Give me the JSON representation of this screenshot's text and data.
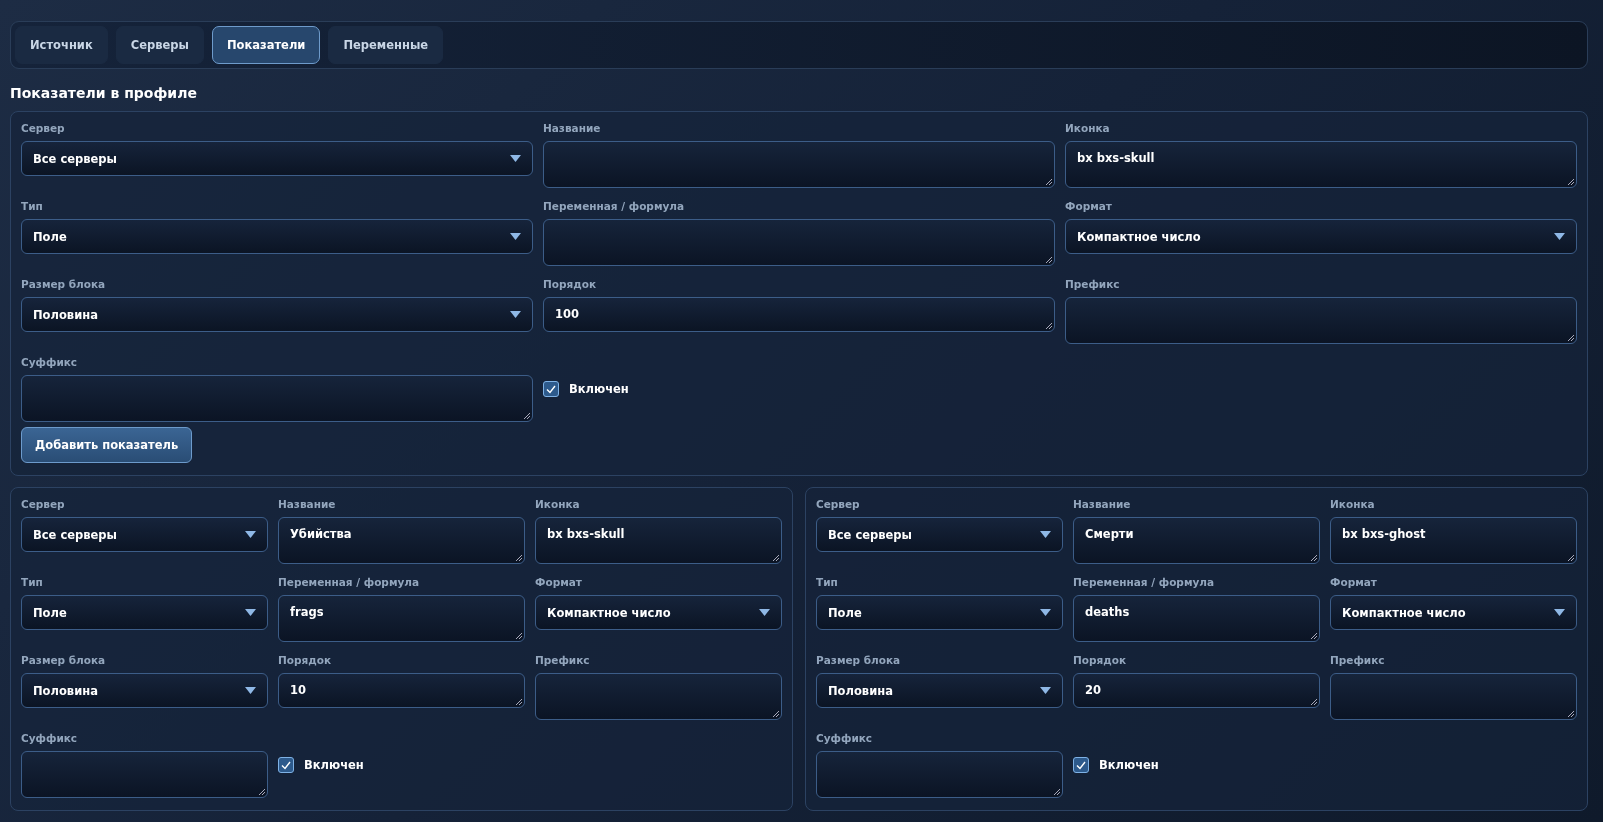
{
  "tabs": [
    {
      "label": "Источник",
      "selected": false
    },
    {
      "label": "Серверы",
      "selected": false
    },
    {
      "label": "Показатели",
      "selected": true
    },
    {
      "label": "Переменные",
      "selected": false
    }
  ],
  "heading": "Показатели в профиле",
  "new_form": {
    "fields": [
      {
        "label": "Сервер",
        "kind": "select",
        "value": "Все серверы"
      },
      {
        "label": "Название",
        "kind": "textarea"
      },
      {
        "label": "Иконка",
        "kind": "textarea",
        "value": "bx bxs-skull"
      },
      {
        "label": "Тип",
        "kind": "select",
        "value": "Поле"
      },
      {
        "label": "Переменная / формула",
        "kind": "textarea"
      },
      {
        "label": "Формат",
        "kind": "select",
        "value": "Компактное число"
      },
      {
        "label": "Размер блока",
        "kind": "select",
        "value": "Половина"
      },
      {
        "label": "Порядок",
        "kind": "input",
        "value": "100"
      },
      {
        "label": "Префикс",
        "kind": "textarea"
      },
      {
        "label": "Суффикс",
        "kind": "textarea"
      }
    ],
    "enabled": {
      "label": "Включен",
      "checked": true
    },
    "button": "Добавить показатель"
  },
  "metrics": [
    {
      "fields": [
        {
          "label": "Сервер",
          "kind": "select",
          "value": "Все серверы"
        },
        {
          "label": "Название",
          "kind": "textarea",
          "value": "Убийства"
        },
        {
          "label": "Иконка",
          "kind": "textarea",
          "value": "bx bxs-skull"
        },
        {
          "label": "Тип",
          "kind": "select",
          "value": "Поле"
        },
        {
          "label": "Переменная / формула",
          "kind": "textarea",
          "value": "frags"
        },
        {
          "label": "Формат",
          "kind": "select",
          "value": "Компактное число"
        },
        {
          "label": "Размер блока",
          "kind": "select",
          "value": "Половина"
        },
        {
          "label": "Порядок",
          "kind": "input",
          "value": "10"
        },
        {
          "label": "Префикс",
          "kind": "textarea"
        },
        {
          "label": "Суффикс",
          "kind": "textarea"
        }
      ],
      "enabled": {
        "label": "Включен",
        "checked": true
      }
    },
    {
      "fields": [
        {
          "label": "Сервер",
          "kind": "select",
          "value": "Все серверы"
        },
        {
          "label": "Название",
          "kind": "textarea",
          "value": "Смерти"
        },
        {
          "label": "Иконка",
          "kind": "textarea",
          "value": "bx bxs-ghost"
        },
        {
          "label": "Тип",
          "kind": "select",
          "value": "Поле"
        },
        {
          "label": "Переменная / формула",
          "kind": "textarea",
          "value": "deaths"
        },
        {
          "label": "Формат",
          "kind": "select",
          "value": "Компактное число"
        },
        {
          "label": "Размер блока",
          "kind": "select",
          "value": "Половина"
        },
        {
          "label": "Порядок",
          "kind": "input",
          "value": "20"
        },
        {
          "label": "Префикс",
          "kind": "textarea"
        },
        {
          "label": "Суффикс",
          "kind": "textarea"
        }
      ],
      "enabled": {
        "label": "Включен",
        "checked": true
      }
    }
  ]
}
